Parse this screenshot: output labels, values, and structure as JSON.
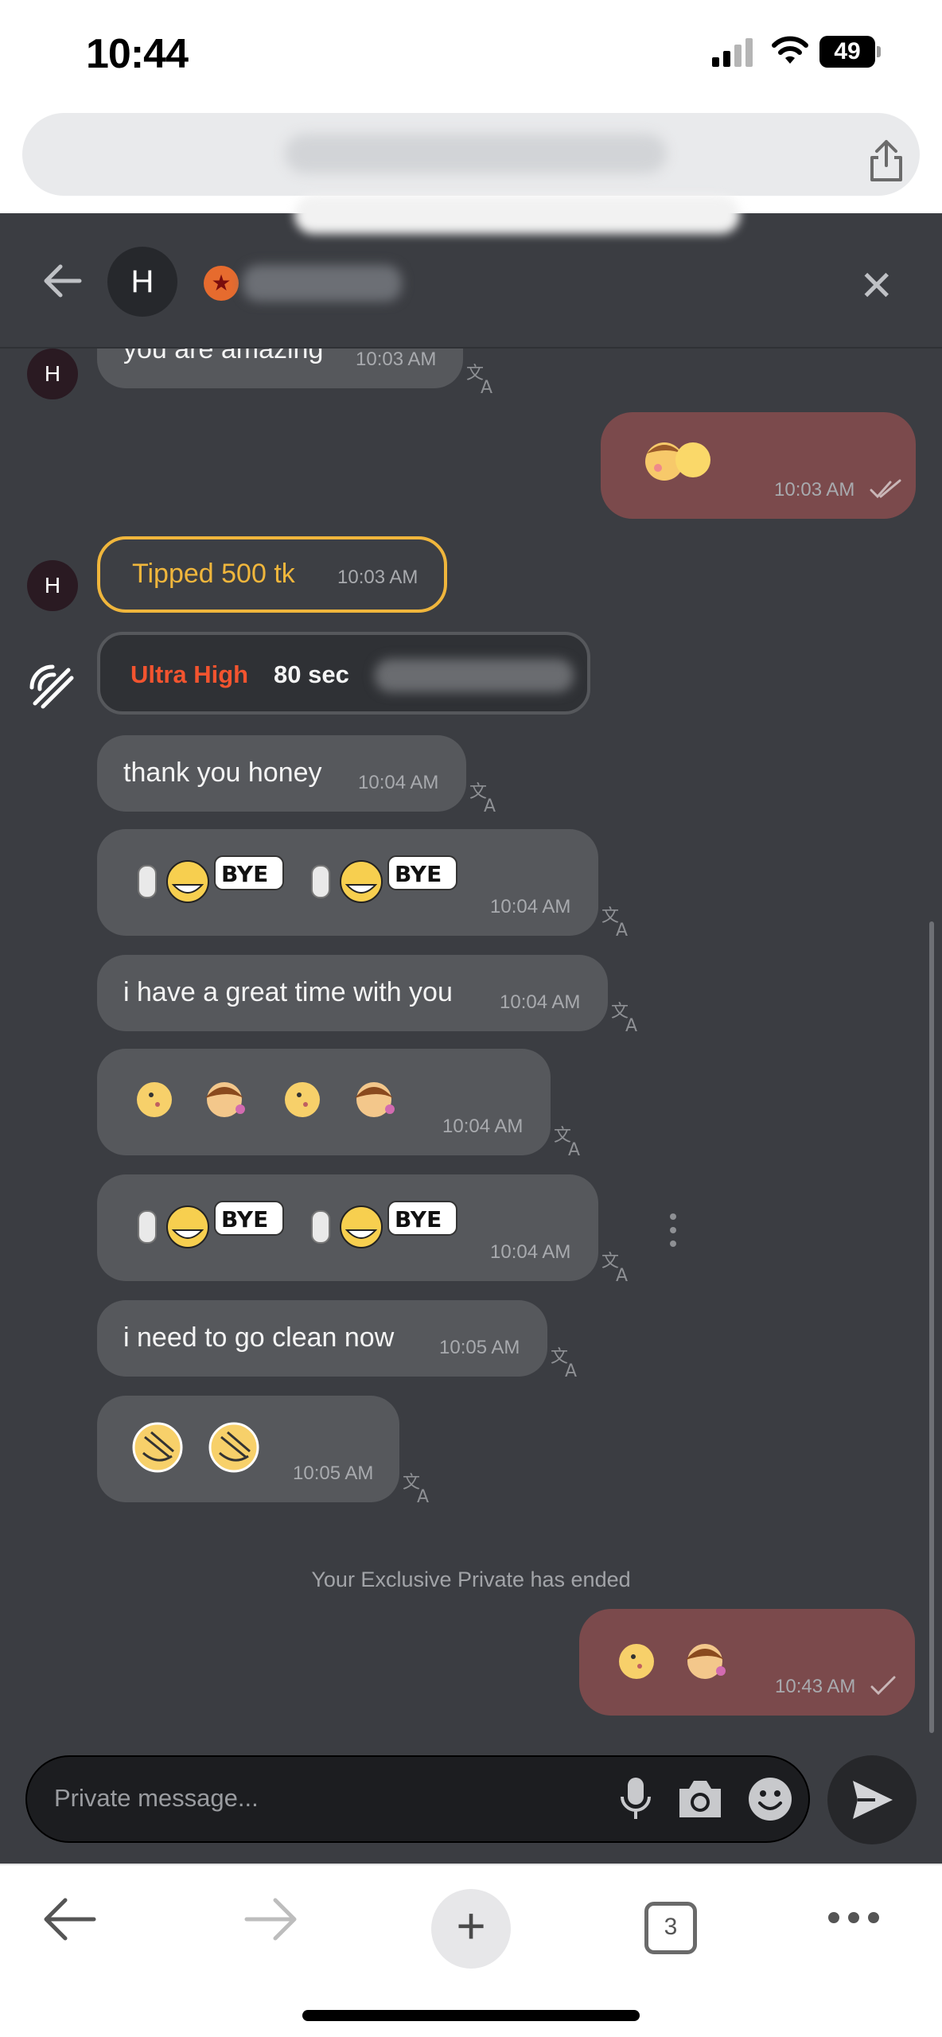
{
  "status_bar": {
    "time": "10:44",
    "battery": "49"
  },
  "header": {
    "avatar_initial": "H"
  },
  "chat": {
    "messages": [
      {
        "text": "you are amazing",
        "time": "10:03 AM"
      },
      {
        "time": "10:03 AM",
        "mine": true
      },
      {
        "text": "Tipped 500 tk",
        "time": "10:03 AM"
      },
      {
        "ultra_label": "Ultra High",
        "ultra_duration": "80 sec"
      },
      {
        "text": "thank you honey",
        "time": "10:04 AM"
      },
      {
        "time": "10:04 AM",
        "emoji": "bye"
      },
      {
        "text": "i have a great time with you",
        "time": "10:04 AM"
      },
      {
        "time": "10:04 AM",
        "emoji": "mixed"
      },
      {
        "time": "10:04 AM",
        "emoji": "bye"
      },
      {
        "text": "i need to go clean now",
        "time": "10:05 AM"
      },
      {
        "time": "10:05 AM",
        "emoji": "tired"
      },
      {
        "time": "10:43 AM",
        "mine": true
      }
    ],
    "system_text": "Your Exclusive Private has ended",
    "sender_initial": "H"
  },
  "composer": {
    "placeholder": "Private message..."
  },
  "browser": {
    "tab_count": "3"
  },
  "icons": [
    "back-arrow-icon",
    "close-icon",
    "share-icon",
    "translate-icon",
    "microphone-icon",
    "camera-icon",
    "smiley-icon",
    "send-icon",
    "plus-icon",
    "tabs-icon",
    "more-icon",
    "ultra-call-icon",
    "read-check-icon"
  ],
  "colors": {
    "background": "#3b3d42",
    "incoming_bubble": "#56585c",
    "outgoing_bubble": "#7b4a4c",
    "tip_accent": "#f0b63c",
    "ultra_accent": "#f3542f"
  }
}
